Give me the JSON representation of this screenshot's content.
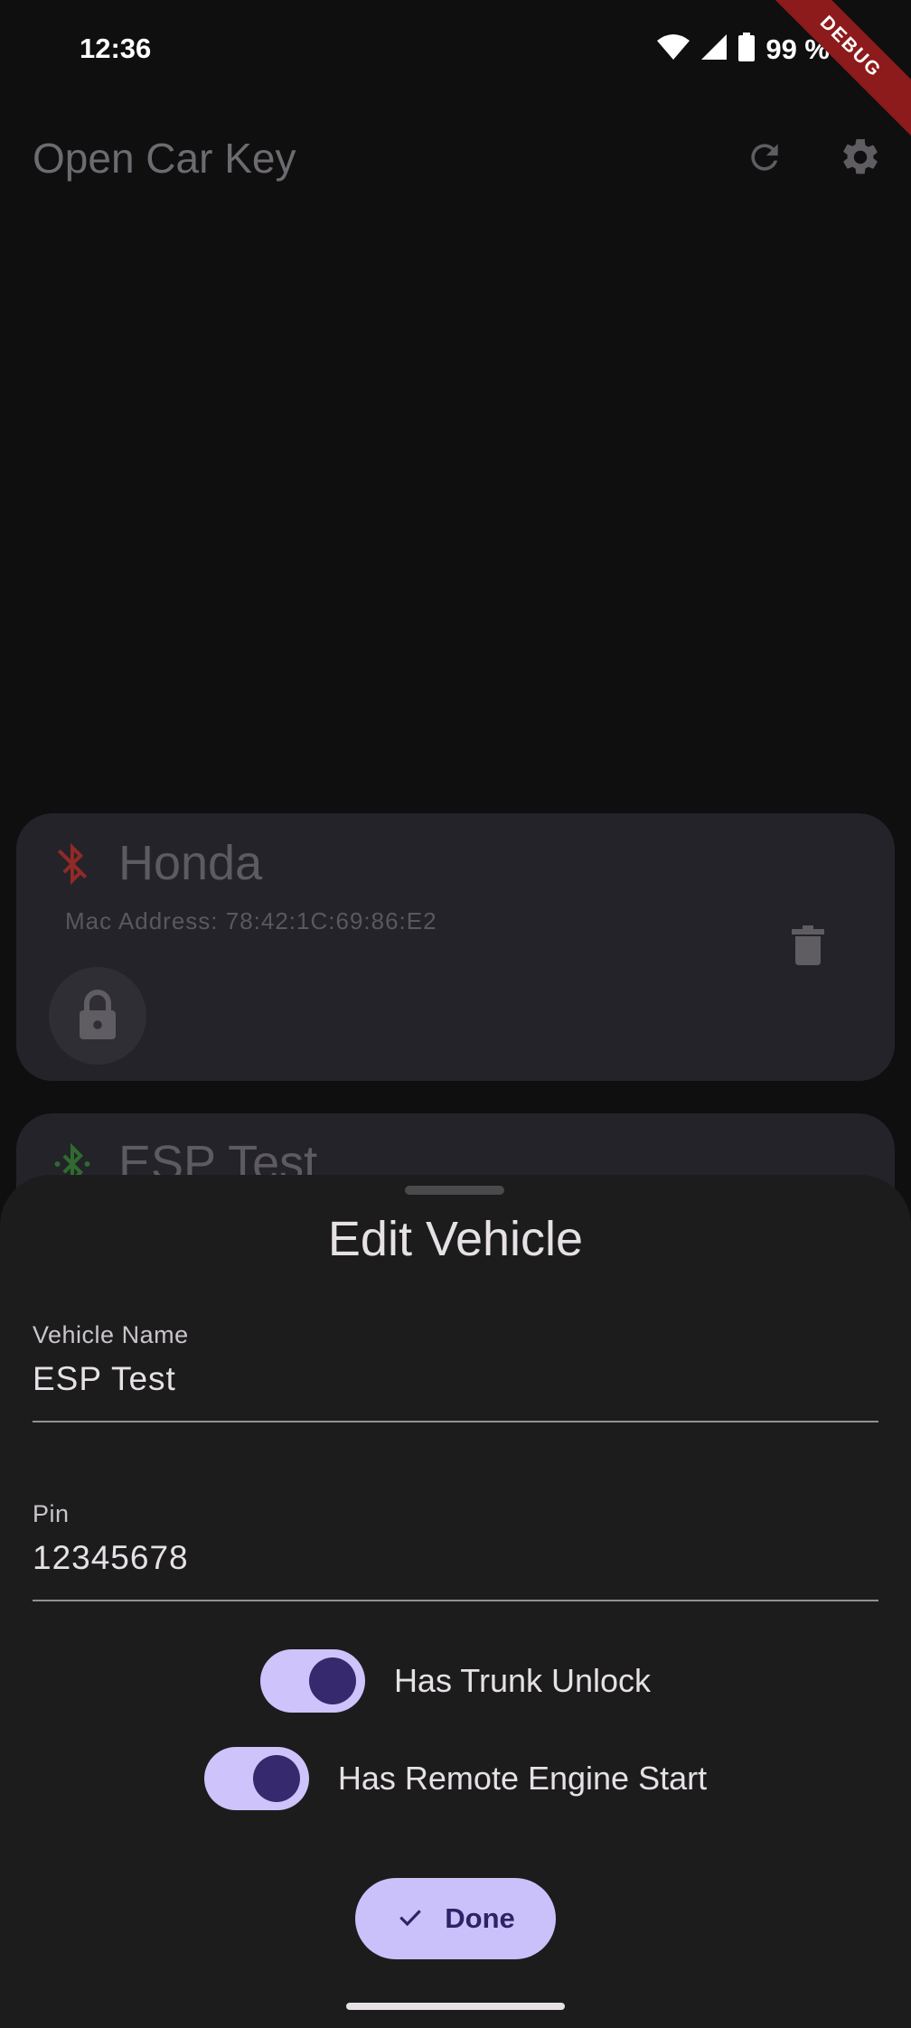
{
  "status_bar": {
    "time": "12:36",
    "battery": "99 %",
    "debug_banner": "DEBUG"
  },
  "app_bar": {
    "title": "Open Car Key",
    "refresh_icon": "refresh-icon",
    "settings_icon": "gear-icon"
  },
  "vehicles": [
    {
      "name": "Honda",
      "mac": "Mac Address: 78:42:1C:69:86:E2",
      "bt_status": "bluetooth-disabled-icon",
      "bt_color": "#8f2a26"
    },
    {
      "name": "ESP Test",
      "bt_status": "bluetooth-connected-icon",
      "bt_color": "#2f6b2f"
    }
  ],
  "sheet": {
    "title": "Edit Vehicle",
    "vehicle_name": {
      "label": "Vehicle Name",
      "value": "ESP Test"
    },
    "pin": {
      "label": "Pin",
      "value": "12345678"
    },
    "toggles": [
      {
        "label": "Has Trunk Unlock",
        "on": true
      },
      {
        "label": "Has Remote Engine Start",
        "on": true
      }
    ],
    "done_label": "Done"
  },
  "colors": {
    "accent": "#cbc1fa",
    "accent_dark": "#37296e",
    "sheet_bg": "#1c1c1d"
  }
}
